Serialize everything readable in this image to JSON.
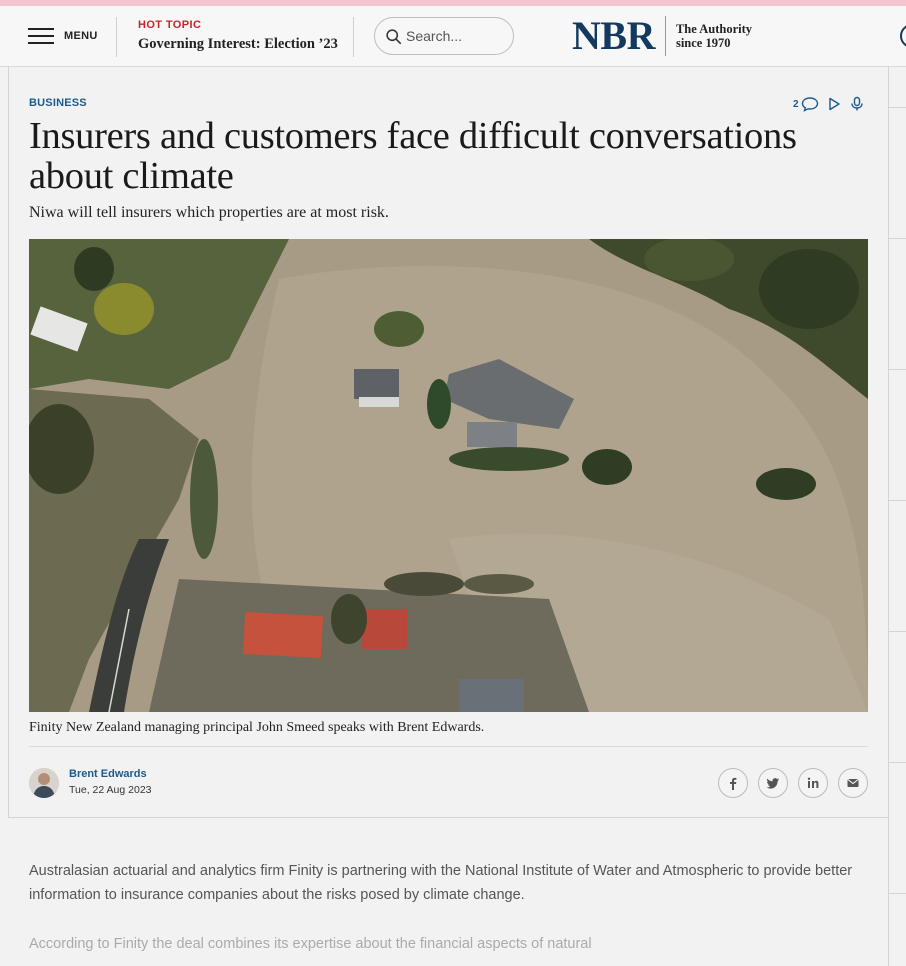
{
  "header": {
    "menu_label": "MENU",
    "hot_topic_kicker": "HOT TOPIC",
    "hot_topic_title": "Governing Interest: Election ’23",
    "search_placeholder": "Search...",
    "logo_text": "NBR",
    "tagline_line1": "The Authority",
    "tagline_line2": "since 1970"
  },
  "article": {
    "section": "BUSINESS",
    "comment_count": "2",
    "headline": "Insurers and customers face difficult conversations about climate",
    "standfirst": "Niwa will tell insurers which properties are at most risk.",
    "image_caption": "Finity New Zealand managing principal John Smeed speaks with Brent Edwards.",
    "author_name": "Brent Edwards",
    "date": "Tue, 22 Aug 2023",
    "paragraphs": [
      "Australasian actuarial and analytics firm Finity is partnering with the National Institute of Water and Atmospheric to provide better information to insurance companies about the risks posed by climate change.",
      "According to Finity the deal combines its expertise about the financial aspects of natural"
    ]
  },
  "icons": {
    "menu": "hamburger-icon",
    "search": "search-icon",
    "comments": "comment-icon",
    "video": "play-icon",
    "audio": "microphone-icon",
    "share": [
      "facebook-icon",
      "twitter-icon",
      "linkedin-icon",
      "email-icon"
    ]
  },
  "colors": {
    "brand": "#133a5e",
    "link": "#1d5a8a",
    "hot_topic": "#c8232c",
    "accent_bar": "#f3c6cf"
  }
}
